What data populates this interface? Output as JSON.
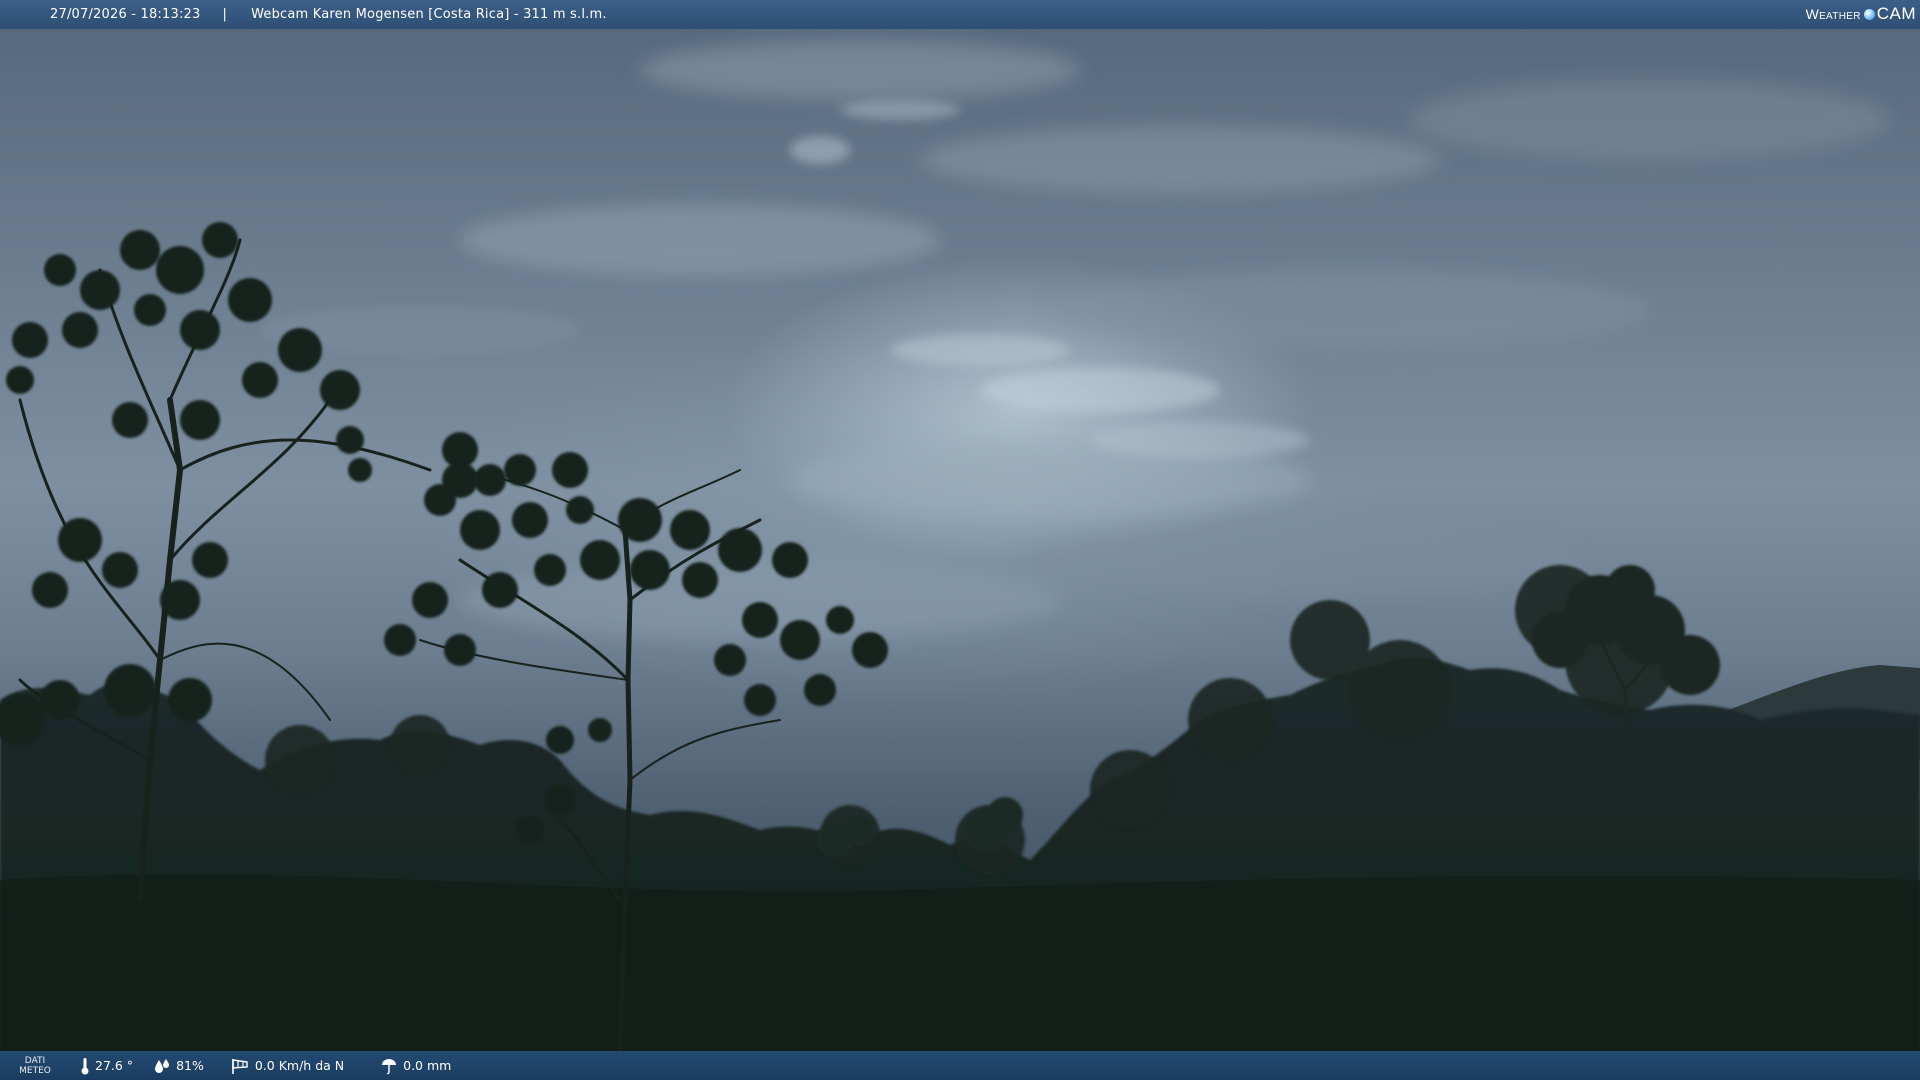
{
  "header": {
    "timestamp": "27/07/2026 - 18:13:23",
    "separator": "|",
    "title": "Webcam Karen Mogensen [Costa Rica] - 311 m s.l.m.",
    "logo_part1": "Weather",
    "logo_part2": "CAM"
  },
  "footer": {
    "dati_line1": "DATI",
    "dati_line2": "METEO",
    "temperature": "27.6 °",
    "humidity": "81%",
    "wind": "0.0 Km/h da N",
    "rain": "0.0 mm"
  },
  "icons": {
    "temperature": "thermometer-icon",
    "humidity": "humidity-drops-icon",
    "wind": "windsock-icon",
    "rain": "rain-gauge-icon",
    "logo": "weathercam-logo"
  },
  "colors": {
    "bar_top": "#345781",
    "bar_bottom": "#1f426a",
    "text": "#ffffff"
  }
}
